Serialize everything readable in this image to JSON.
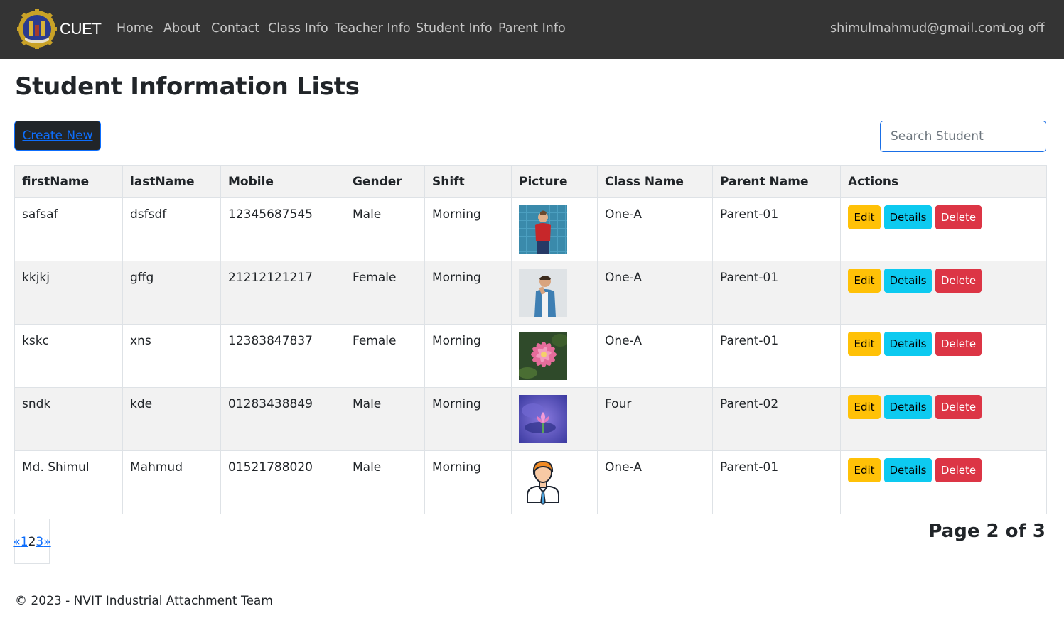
{
  "nav": {
    "brand": "CUET",
    "links": [
      "Home",
      "About",
      "Contact",
      "Class Info",
      "Teacher Info",
      "Student Info",
      "Parent Info"
    ],
    "user_email": "shimulmahmud@gmail.com",
    "logoff": "Log off"
  },
  "page": {
    "title": "Student Information Lists",
    "create_label": "Create New",
    "search_placeholder": "Search Student"
  },
  "table": {
    "headers": [
      "firstName",
      "lastName",
      "Mobile",
      "Gender",
      "Shift",
      "Picture",
      "Class Name",
      "Parent Name",
      "Actions"
    ],
    "rows": [
      {
        "first": "safsaf",
        "last": "dsfsdf",
        "mobile": "12345687545",
        "gender": "Male",
        "shift": "Morning",
        "picture": "man-red-shirt-photo",
        "class": "One-A",
        "parent": "Parent-01"
      },
      {
        "first": "kkjkj",
        "last": "gffg",
        "mobile": "21212121217",
        "gender": "Female",
        "shift": "Morning",
        "picture": "man-thinking-photo",
        "class": "One-A",
        "parent": "Parent-01"
      },
      {
        "first": "kskc",
        "last": "xns",
        "mobile": "12383847837",
        "gender": "Female",
        "shift": "Morning",
        "picture": "pink-flower-photo",
        "class": "One-A",
        "parent": "Parent-01"
      },
      {
        "first": "sndk",
        "last": "kde",
        "mobile": "01283438849",
        "gender": "Male",
        "shift": "Morning",
        "picture": "purple-lotus-photo",
        "class": "Four",
        "parent": "Parent-02"
      },
      {
        "first": "Md. Shimul",
        "last": "Mahmud",
        "mobile": "01521788020",
        "gender": "Male",
        "shift": "Morning",
        "picture": "avatar-illustration",
        "class": "One-A",
        "parent": "Parent-01"
      }
    ],
    "actions": {
      "edit": "Edit",
      "details": "Details",
      "delete": "Delete"
    }
  },
  "pagination": {
    "prev": "«",
    "pages": [
      "1",
      "2",
      "3"
    ],
    "current": "2",
    "next": "»",
    "info": "Page 2 of 3"
  },
  "footer": {
    "text": "© 2023 - NVIT Industrial Attachment Team"
  },
  "colors": {
    "navbar": "#343434",
    "link": "#0d6efd",
    "edit": "#ffc107",
    "details": "#0dcaf0",
    "delete": "#dc3545"
  }
}
